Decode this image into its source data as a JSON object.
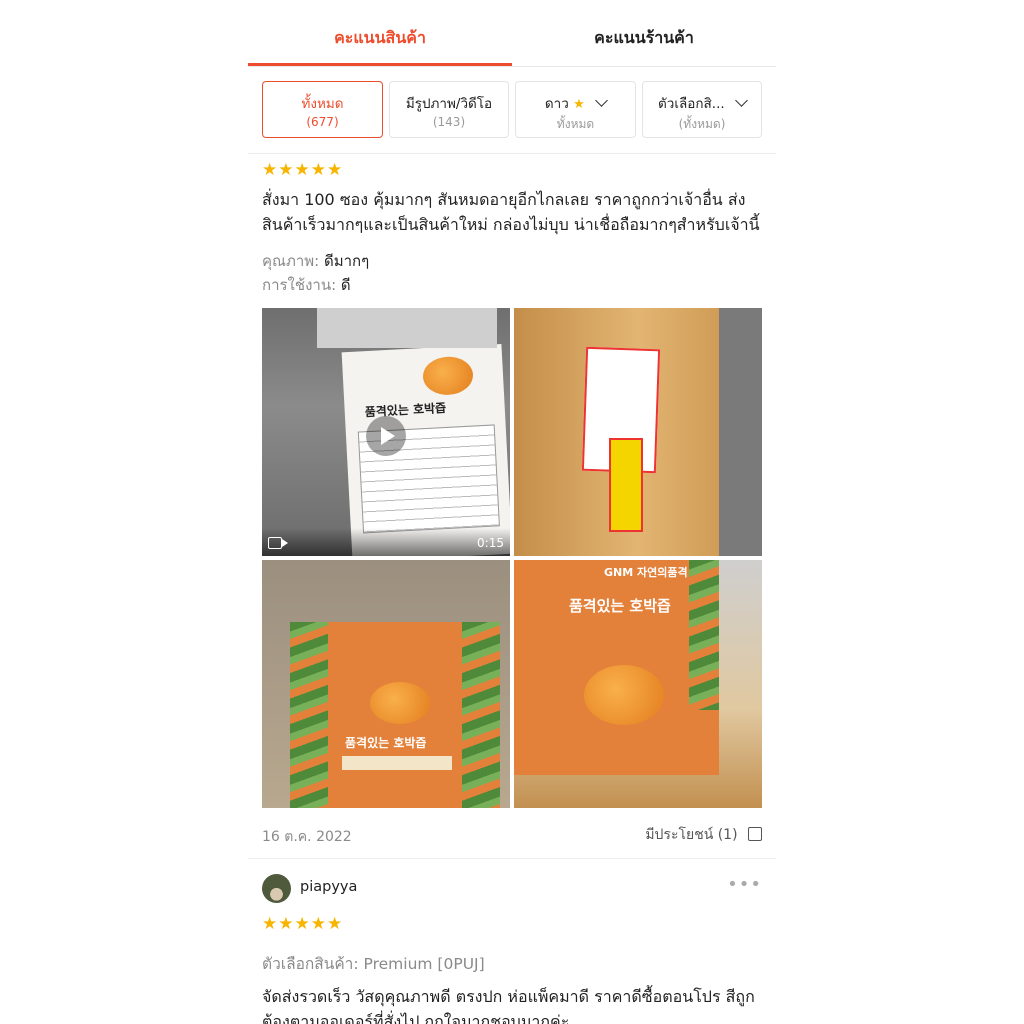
{
  "tabs": [
    {
      "label": "คะแนนสินค้า",
      "active": true
    },
    {
      "label": "คะแนนร้านค้า",
      "active": false
    }
  ],
  "filters": [
    {
      "label": "ทั้งหมด",
      "sub": "(677)",
      "active": true
    },
    {
      "label": "มีรูปภาพ/วิดีโอ",
      "sub": "(143)",
      "active": false
    },
    {
      "label": "ดาว",
      "sub": "ทั้งหมด",
      "icon": "star-icon",
      "dropdown": true
    },
    {
      "label": "ตัวเลือกสิ...",
      "sub": "(ทั้งหมด)",
      "dropdown": true
    }
  ],
  "review1": {
    "rating": 5,
    "stars": "★★★★★",
    "text_line1": "สั่งมา 100 ซอง คุ้มมากๆ  สันหมดอายุอีกไกลเลย ราคาถูกกว่าเจ้าอื่น  ส่ง",
    "text_line2": "สินค้าเร็วมากๆและเป็นสินค้าใหม่ กล่องไม่บุบ น่าเชื่อถือมากๆสำหรับเจ้านี้",
    "quality_key": "คุณภาพ:",
    "quality_value": "ดีมากๆ",
    "usage_key": "การใช้งาน:",
    "usage_value": "ดี",
    "video_duration": "0:15",
    "date": "16 ต.ค. 2022",
    "helpful": "มีประโยชน์ (1)"
  },
  "review2": {
    "username": "piapyya",
    "rating": 5,
    "stars": "★★★★★",
    "variation": "ตัวเลือกสินค้า: Premium [0PUJ]",
    "text_line1": "จัดส่งรวดเร็ว วัสดุคุณภาพดี ตรงปก ห่อแพ็คมาดี ราคาดีซื้อตอนโปร สีถูก",
    "text_line2": "ต้องตามออเดอร์ที่สั่งไป ถูกใจมากชอบมากค่ะ"
  },
  "product_label": "품격있는 호박즙",
  "brand": "GNM 자연의품격",
  "colors": {
    "accent": "#ee4d2d",
    "star": "#f7b500"
  }
}
